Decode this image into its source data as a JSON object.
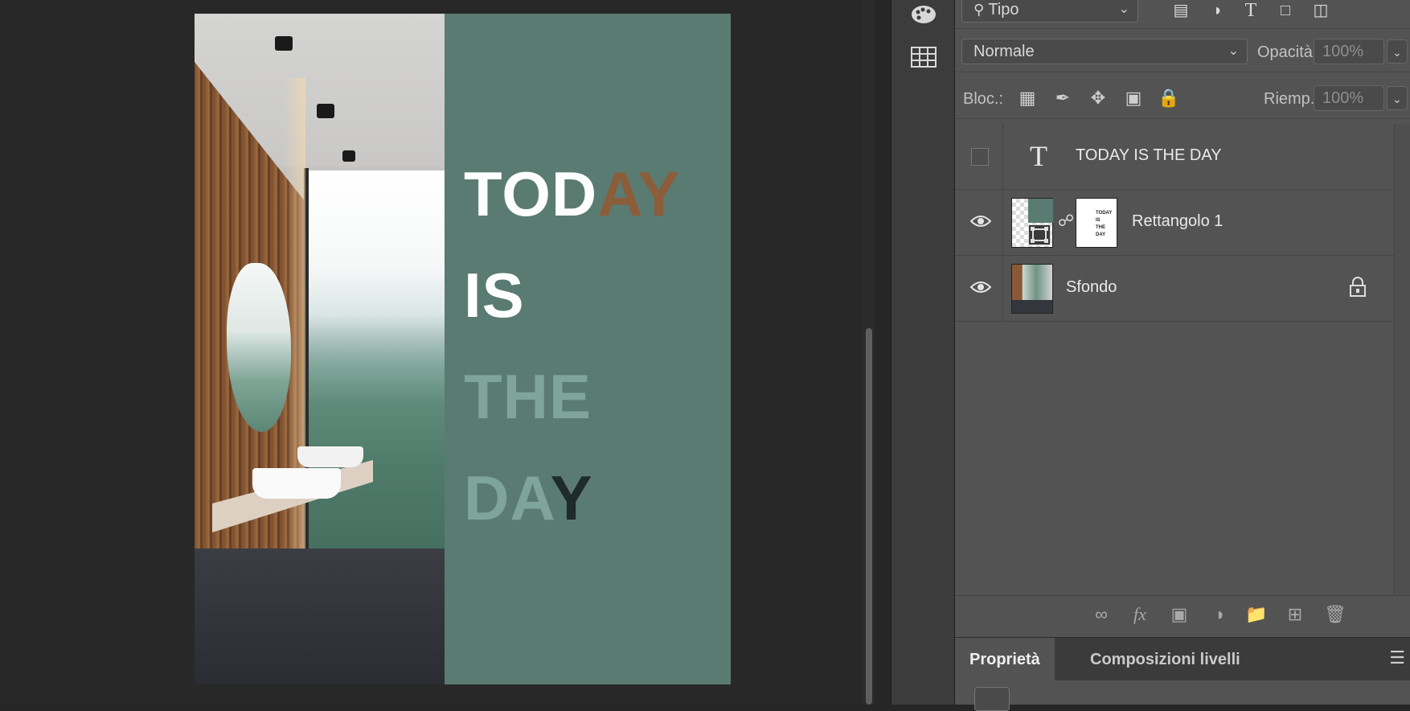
{
  "document": {
    "headline_lines": [
      {
        "plain": "TOD",
        "accent": "AY",
        "accent_style": "wood"
      },
      {
        "plain": "IS",
        "accent": "",
        "accent_style": "none"
      },
      {
        "plain": "THE",
        "accent": "",
        "accent_style": "ghost"
      },
      {
        "plain": "DA",
        "accent": "Y",
        "accent_style": "dark"
      }
    ]
  },
  "tool_strip": {
    "icons": [
      "palette-icon",
      "grid-icon"
    ]
  },
  "layers_panel": {
    "filter": {
      "label": "Tipo",
      "icon": "search-icon"
    },
    "filter_icons": [
      "image-filter-icon",
      "adjustment-filter-icon",
      "type-filter-icon",
      "shape-filter-icon",
      "smart-object-filter-icon"
    ],
    "blend_mode": "Normale",
    "opacity_label": "Opacità:",
    "opacity_value": "100%",
    "lock_label": "Bloc.:",
    "lock_icons": [
      "lock-transparent-icon",
      "lock-brush-icon",
      "lock-move-icon",
      "lock-artboard-icon",
      "lock-all-icon"
    ],
    "fill_label": "Riemp.:",
    "fill_value": "100%",
    "layers": [
      {
        "name": "TODAY IS THE  DAY",
        "type": "text",
        "visible": false
      },
      {
        "name": "Rettangolo 1",
        "type": "shape-with-mask",
        "visible": true,
        "mask_text": "TODAY\nIS\nTHE\nDAY"
      },
      {
        "name": "Sfondo",
        "type": "background",
        "visible": true,
        "locked": true
      }
    ],
    "footer_icons": [
      "link-layers-icon",
      "fx-icon",
      "add-mask-icon",
      "adjustment-layer-icon",
      "folder-icon",
      "new-layer-icon",
      "trash-icon"
    ]
  },
  "properties_panel": {
    "tabs": [
      "Proprietà",
      "Composizioni livelli"
    ],
    "active_tab": 0
  },
  "colors": {
    "doc_green": "#5a7b71",
    "panel_bg": "#535353"
  }
}
